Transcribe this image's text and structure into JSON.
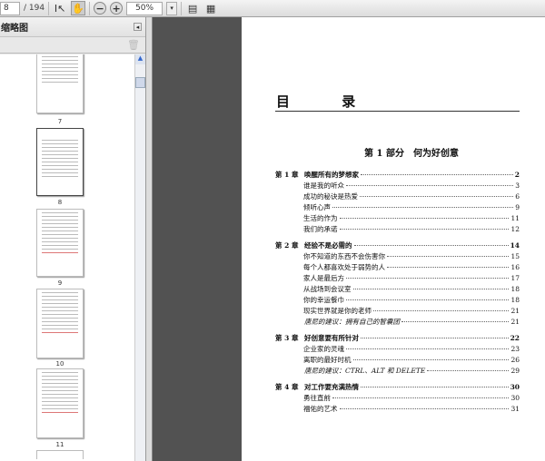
{
  "toolbar": {
    "page_current": "8",
    "page_total": "/ 194",
    "zoom": "50%"
  },
  "sidebar": {
    "title": "缩略图",
    "thumbnails": [
      "7",
      "8",
      "9",
      "10",
      "11"
    ]
  },
  "document": {
    "title": "目 录",
    "part": "第 1 部分　何为好创意",
    "toc": [
      {
        "type": "ch",
        "num": "第 1 章",
        "title": "唤醒所有的梦想家",
        "page": "2"
      },
      {
        "type": "sub",
        "title": "谁是我的听众",
        "page": "3"
      },
      {
        "type": "sub",
        "title": "成功的秘诀是热爱",
        "page": "6"
      },
      {
        "type": "sub",
        "title": "倾听心声",
        "page": "9"
      },
      {
        "type": "sub",
        "title": "生活的作为",
        "page": "11"
      },
      {
        "type": "sub",
        "title": "我们的承诺",
        "page": "12"
      },
      {
        "type": "ch",
        "num": "第 2 章",
        "title": "经验不是必需的",
        "page": "14"
      },
      {
        "type": "sub",
        "title": "你不知道的东西不会伤害你",
        "page": "15"
      },
      {
        "type": "sub",
        "title": "每个人都喜欢处于弱势的人",
        "page": "16"
      },
      {
        "type": "sub",
        "title": "家人是最后方",
        "page": "17"
      },
      {
        "type": "sub",
        "title": "从战场到会议室",
        "page": "18"
      },
      {
        "type": "sub",
        "title": "你的幸运餐巾",
        "page": "18"
      },
      {
        "type": "sub",
        "title": "现实世界就是你的老师",
        "page": "21"
      },
      {
        "type": "it",
        "title": "唐尼的建议：拥有自己的智囊团",
        "page": "21"
      },
      {
        "type": "ch",
        "num": "第 3 章",
        "title": "好创意要有所针对",
        "page": "22"
      },
      {
        "type": "sub",
        "title": "企业家的灵魂",
        "page": "23"
      },
      {
        "type": "sub",
        "title": "离职的最好时机",
        "page": "26"
      },
      {
        "type": "it",
        "title": "唐尼的建议：CTRL、ALT 和 DELETE",
        "page": "29"
      },
      {
        "type": "ch",
        "num": "第 4 章",
        "title": "对工作要充满热情",
        "page": "30"
      },
      {
        "type": "sub",
        "title": "勇往直前",
        "page": "30"
      },
      {
        "type": "sub",
        "title": "福佑的艺术",
        "page": "31"
      }
    ]
  }
}
